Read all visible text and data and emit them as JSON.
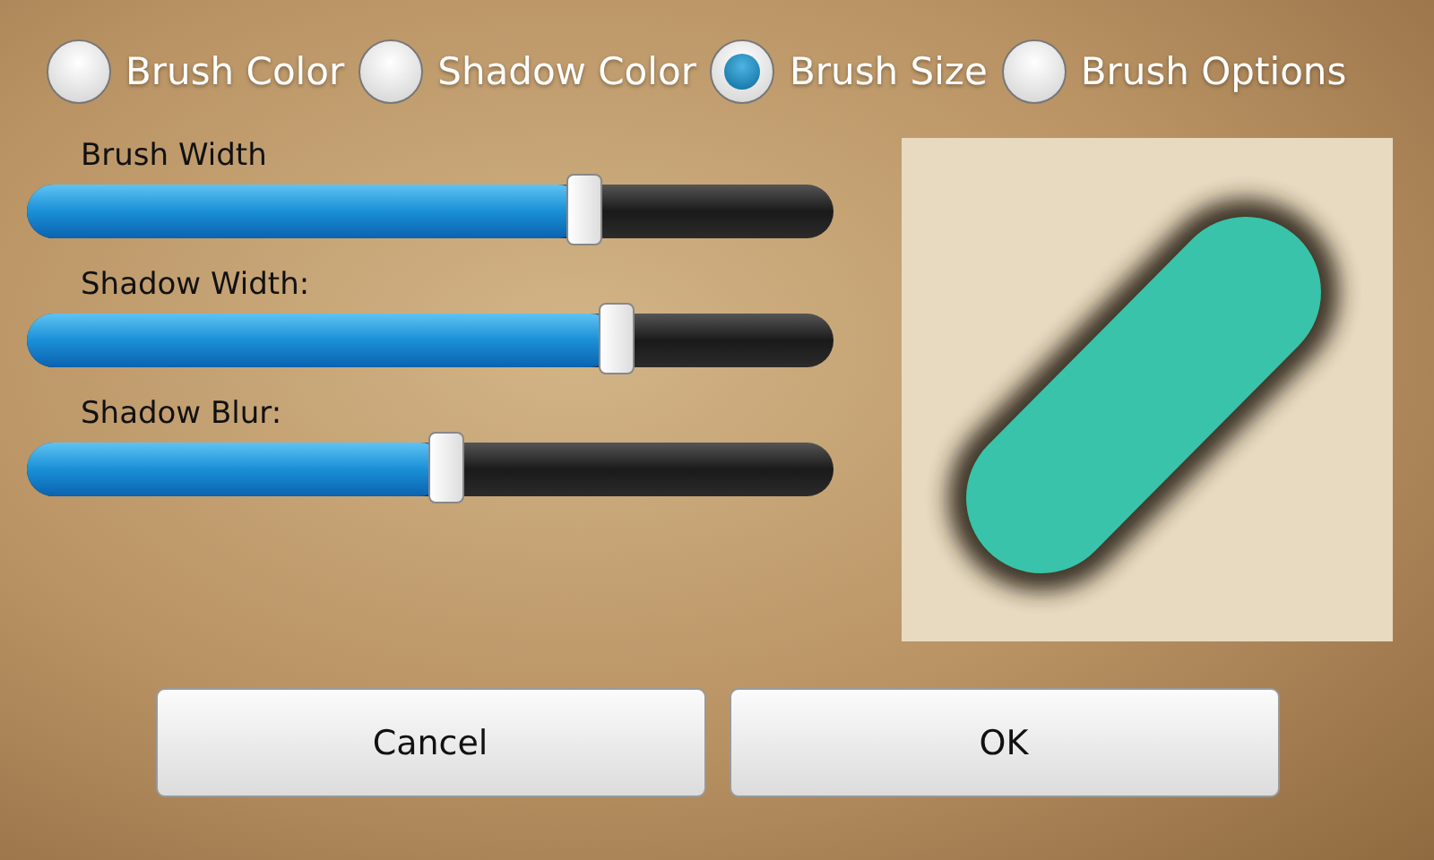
{
  "tabs": [
    {
      "label": "Brush Color",
      "selected": false
    },
    {
      "label": "Shadow Color",
      "selected": false
    },
    {
      "label": "Brush Size",
      "selected": true
    },
    {
      "label": "Brush Options",
      "selected": false
    }
  ],
  "sliders": [
    {
      "label": "Brush Width",
      "level": 0.69
    },
    {
      "label": "Shadow Width:",
      "level": 0.73
    },
    {
      "label": "Shadow Blur:",
      "level": 0.52
    }
  ],
  "buttons": [
    "Cancel",
    "OK"
  ]
}
